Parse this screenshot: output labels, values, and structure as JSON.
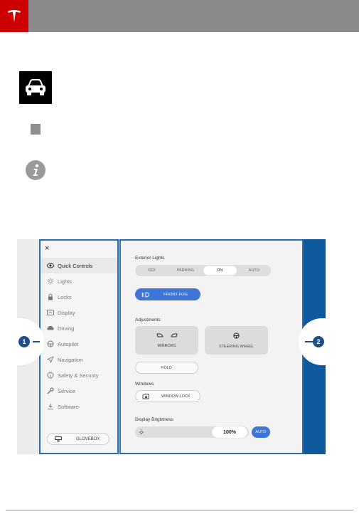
{
  "brand": {
    "logo_name": "tesla-logo",
    "color": "#cc0000"
  },
  "header": {
    "color": "#8a8a8a"
  },
  "screen": {
    "close_glyph": "×",
    "menu": [
      {
        "label": "Quick Controls",
        "icon": "eye-icon",
        "active": true
      },
      {
        "label": "Lights",
        "icon": "sun-icon"
      },
      {
        "label": "Locks",
        "icon": "lock-icon"
      },
      {
        "label": "Display",
        "icon": "display-icon"
      },
      {
        "label": "Driving",
        "icon": "car-icon"
      },
      {
        "label": "Autopilot",
        "icon": "steering-wheel-icon"
      },
      {
        "label": "Navigation",
        "icon": "navigation-arrow-icon"
      },
      {
        "label": "Safety & Security",
        "icon": "info-circle-icon"
      },
      {
        "label": "Service",
        "icon": "wrench-icon"
      },
      {
        "label": "Software",
        "icon": "download-icon"
      }
    ],
    "glovebox_label": "GLOVEBOX",
    "exterior_lights": {
      "title": "Exterior Lights",
      "options": [
        "OFF",
        "PARKING",
        "ON",
        "AUTO"
      ],
      "selected": "ON"
    },
    "front_fog_label": "FRONT FOG",
    "adjustments": {
      "title": "Adjustments",
      "mirrors_label": "MIRRORS",
      "steering_label": "STEERING WHEEL",
      "fold_label": "FOLD"
    },
    "windows": {
      "title": "Windows",
      "lock_label": "WINDOW LOCK"
    },
    "brightness": {
      "title": "Display Brightness",
      "value": "100%",
      "level": 1.0,
      "auto_label": "AUTO"
    },
    "accent_color": "#3f74d9",
    "frame_color": "#2a6db5"
  },
  "callouts": {
    "left": "1",
    "right": "2"
  }
}
